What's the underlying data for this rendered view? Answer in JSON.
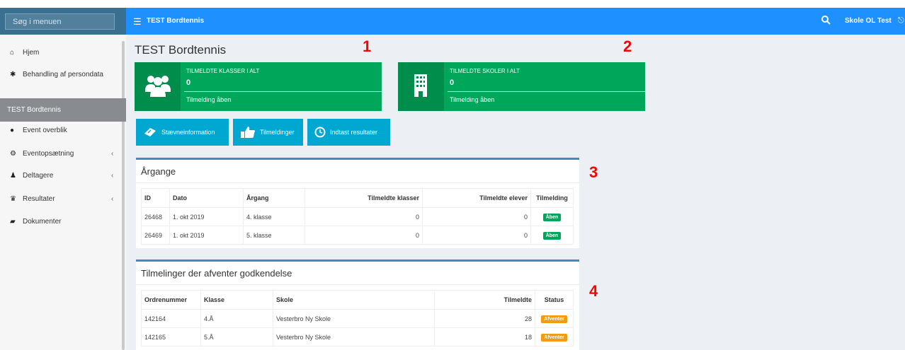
{
  "header": {
    "search_placeholder": "Søg i menuen",
    "app_title": "TEST Bordtennis",
    "user_name": "Skole OL Test"
  },
  "sidebar": {
    "items_top": [
      {
        "label": "Hjem",
        "icon": "home-icon"
      },
      {
        "label": "Behandling af persondata",
        "icon": "asterisk-icon"
      }
    ],
    "section_label": "TEST Bordtennis",
    "items": [
      {
        "label": "Event overblik",
        "icon": "globe-icon"
      },
      {
        "label": "Eventopsætning",
        "icon": "cogs-icon",
        "chevron": "‹"
      },
      {
        "label": "Deltagere",
        "icon": "users-icon",
        "chevron": "‹"
      },
      {
        "label": "Resultater",
        "icon": "trophy-icon",
        "chevron": "‹"
      },
      {
        "label": "Dokumenter",
        "icon": "book-icon"
      }
    ]
  },
  "page": {
    "title": "TEST Bordtennis"
  },
  "info_boxes": [
    {
      "label": "TILMELDTE KLASSER I ALT",
      "value": "0",
      "footer": "Tilmelding åben",
      "icon": "users-icon"
    },
    {
      "label": "TILMELDTE SKOLER I ALT",
      "value": "0",
      "footer": "Tilmelding åben",
      "icon": "building-icon"
    }
  ],
  "annotations": [
    "1",
    "2",
    "3",
    "4"
  ],
  "buttons": [
    {
      "label": "Stævneinformation",
      "icon": "ticket-icon"
    },
    {
      "label": "Tilmeldinger",
      "icon": "thumbs-up-icon"
    },
    {
      "label": "Indtast resultater",
      "icon": "clock-icon"
    }
  ],
  "aargange": {
    "title": "Årgange",
    "columns": [
      "ID",
      "Dato",
      "Årgang",
      "Tilmeldte klasser",
      "Tilmeldte elever",
      "Tilmelding"
    ],
    "rows": [
      {
        "id": "26468",
        "dato": "1. okt 2019",
        "aargang": "4. klasse",
        "klasser": "0",
        "elever": "0",
        "status": "Åben"
      },
      {
        "id": "26469",
        "dato": "1. okt 2019",
        "aargang": "5. klasse",
        "klasser": "0",
        "elever": "0",
        "status": "Åben"
      }
    ]
  },
  "pending": {
    "title": "Tilmelinger der afventer godkendelse",
    "columns": [
      "Ordrenummer",
      "Klasse",
      "Skole",
      "Tilmeldte",
      "Status"
    ],
    "rows": [
      {
        "ordre": "142164",
        "klasse": "4.Å",
        "skole": "Vesterbro Ny Skole",
        "tilmeldte": "28",
        "status": "Afventer"
      },
      {
        "ordre": "142165",
        "klasse": "5.Å",
        "skole": "Vesterbro Ny Skole",
        "tilmeldte": "18",
        "status": "Afventer"
      }
    ]
  },
  "colors": {
    "header_blue": "#1e90ff",
    "success_green": "#00a65a",
    "info_cyan": "#00a7d0",
    "warning_orange": "#f39c12",
    "annotation_red": "#ff0000"
  }
}
